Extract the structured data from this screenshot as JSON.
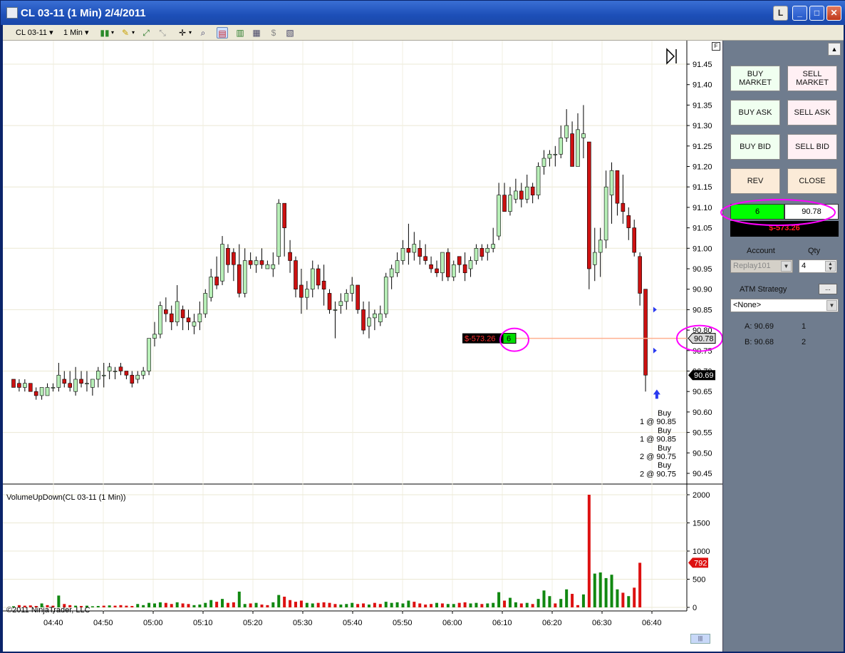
{
  "window": {
    "title": "CL 03-11 (1 Min)  2/4/2011",
    "layout_btn": "L",
    "min_btn": "_",
    "max_btn": "□",
    "close_btn": "✕"
  },
  "toolbar": {
    "instrument": "CL 03-11",
    "interval": "1 Min"
  },
  "chart": {
    "f_label": "F",
    "indicator_label": "VolumeUpDown(CL 03-11 (1 Min))",
    "copyright": "©2011 NinjaTrader, LLC",
    "last_price_label": "90.69",
    "pos_price_label": "90.78",
    "volume_last_label": "792",
    "pos_pnl_label": "$-573.26",
    "pos_qty_label": "6",
    "executions": [
      "Buy",
      "1 @ 90.85",
      "Buy",
      "1 @ 90.85",
      "Buy",
      "2 @ 90.75",
      "Buy",
      "2 @ 90.75"
    ]
  },
  "chart_data": {
    "type": "candlestick",
    "price_axis": {
      "min": 90.45,
      "max": 91.45,
      "ticks": [
        "91.45",
        "91.40",
        "91.35",
        "91.30",
        "91.25",
        "91.20",
        "91.15",
        "91.10",
        "91.05",
        "91.00",
        "90.95",
        "90.90",
        "90.85",
        "90.80",
        "90.75",
        "90.70",
        "90.65",
        "90.60",
        "90.55",
        "90.50",
        "90.45"
      ]
    },
    "volume_axis": {
      "min": 0,
      "max": 2000,
      "ticks": [
        "2000",
        "1500",
        "1000",
        "500",
        "0"
      ]
    },
    "time_ticks": [
      "04:40",
      "04:50",
      "05:00",
      "05:10",
      "05:20",
      "05:30",
      "05:40",
      "05:50",
      "06:00",
      "06:10",
      "06:20",
      "06:30",
      "06:40"
    ],
    "candles": [
      [
        90.68,
        90.68,
        90.66,
        90.66
      ],
      [
        90.67,
        90.68,
        90.65,
        90.66
      ],
      [
        90.66,
        90.68,
        90.65,
        90.67
      ],
      [
        90.67,
        90.67,
        90.65,
        90.65
      ],
      [
        90.65,
        90.66,
        90.63,
        90.64
      ],
      [
        90.64,
        90.66,
        90.63,
        90.66
      ],
      [
        90.64,
        90.67,
        90.64,
        90.66
      ],
      [
        90.66,
        90.67,
        90.65,
        90.66
      ],
      [
        90.66,
        90.72,
        90.65,
        90.69
      ],
      [
        90.68,
        90.7,
        90.66,
        90.67
      ],
      [
        90.67,
        90.7,
        90.65,
        90.66
      ],
      [
        90.65,
        90.71,
        90.64,
        90.68
      ],
      [
        90.68,
        90.7,
        90.66,
        90.67
      ],
      [
        90.67,
        90.7,
        90.65,
        90.67
      ],
      [
        90.66,
        90.68,
        90.64,
        90.68
      ],
      [
        90.68,
        90.71,
        90.66,
        90.7
      ],
      [
        90.69,
        90.72,
        90.66,
        90.69
      ],
      [
        90.7,
        90.72,
        90.68,
        90.71
      ],
      [
        90.7,
        90.71,
        90.68,
        90.7
      ],
      [
        90.71,
        90.72,
        90.69,
        90.7
      ],
      [
        90.7,
        90.7,
        90.68,
        90.69
      ],
      [
        90.69,
        90.7,
        90.66,
        90.67
      ],
      [
        90.68,
        90.7,
        90.67,
        90.69
      ],
      [
        90.69,
        90.71,
        90.68,
        90.7
      ],
      [
        90.7,
        90.76,
        90.69,
        90.78
      ],
      [
        90.78,
        90.82,
        90.76,
        90.79
      ],
      [
        90.79,
        90.87,
        90.78,
        90.86
      ],
      [
        90.85,
        90.88,
        90.82,
        90.84
      ],
      [
        90.84,
        90.86,
        90.8,
        90.82
      ],
      [
        90.82,
        90.91,
        90.81,
        90.87
      ],
      [
        90.85,
        90.86,
        90.8,
        90.83
      ],
      [
        90.83,
        90.85,
        90.8,
        90.82
      ],
      [
        90.81,
        90.84,
        90.79,
        90.82
      ],
      [
        90.82,
        90.87,
        90.8,
        90.84
      ],
      [
        90.84,
        90.9,
        90.83,
        90.89
      ],
      [
        90.88,
        90.95,
        90.87,
        90.93
      ],
      [
        90.93,
        90.98,
        90.9,
        90.91
      ],
      [
        90.92,
        91.03,
        90.91,
        91.01
      ],
      [
        91.0,
        91.01,
        90.94,
        90.96
      ],
      [
        90.99,
        91.0,
        90.92,
        90.96
      ],
      [
        90.96,
        91.01,
        90.88,
        90.89
      ],
      [
        90.89,
        91.0,
        90.88,
        90.97
      ],
      [
        90.97,
        90.99,
        90.95,
        90.96
      ],
      [
        90.96,
        90.98,
        90.94,
        90.97
      ],
      [
        90.97,
        91.0,
        90.95,
        90.96
      ],
      [
        90.95,
        90.97,
        90.95,
        90.96
      ],
      [
        90.95,
        90.99,
        90.93,
        90.96
      ],
      [
        90.98,
        91.12,
        90.96,
        91.11
      ],
      [
        91.11,
        91.1,
        90.98,
        91.05
      ],
      [
        90.99,
        91.02,
        90.94,
        90.97
      ],
      [
        90.97,
        90.98,
        90.88,
        90.9
      ],
      [
        90.91,
        90.95,
        90.84,
        90.88
      ],
      [
        90.88,
        90.92,
        90.85,
        90.9
      ],
      [
        90.9,
        90.97,
        90.88,
        90.95
      ],
      [
        90.95,
        90.96,
        90.9,
        90.91
      ],
      [
        90.92,
        90.96,
        90.86,
        90.9
      ],
      [
        90.89,
        90.9,
        90.84,
        90.85
      ],
      [
        90.85,
        90.87,
        90.78,
        90.85
      ],
      [
        90.86,
        90.89,
        90.84,
        90.87
      ],
      [
        90.87,
        90.9,
        90.85,
        90.89
      ],
      [
        90.89,
        90.93,
        90.87,
        90.91
      ],
      [
        90.91,
        90.91,
        90.84,
        90.85
      ],
      [
        90.85,
        90.87,
        90.79,
        90.8
      ],
      [
        90.81,
        90.87,
        90.78,
        90.83
      ],
      [
        90.83,
        90.85,
        90.8,
        90.84
      ],
      [
        90.82,
        90.86,
        90.81,
        90.84
      ],
      [
        90.84,
        90.94,
        90.83,
        90.93
      ],
      [
        90.93,
        90.96,
        90.9,
        90.95
      ],
      [
        90.94,
        90.99,
        90.93,
        90.97
      ],
      [
        90.97,
        91.02,
        90.96,
        91.0
      ],
      [
        91.0,
        91.06,
        90.96,
        90.99
      ],
      [
        90.99,
        91.04,
        90.97,
        91.01
      ],
      [
        91.0,
        91.02,
        90.96,
        90.98
      ],
      [
        90.98,
        91.01,
        90.96,
        90.97
      ],
      [
        90.96,
        90.98,
        90.94,
        90.95
      ],
      [
        90.95,
        90.97,
        90.93,
        90.94
      ],
      [
        90.94,
        90.98,
        90.92,
        90.99
      ],
      [
        90.99,
        91.0,
        90.92,
        90.93
      ],
      [
        90.93,
        90.97,
        90.92,
        90.96
      ],
      [
        90.98,
        90.98,
        90.94,
        90.96
      ],
      [
        90.96,
        90.99,
        90.92,
        90.94
      ],
      [
        90.95,
        90.98,
        90.93,
        90.97
      ],
      [
        90.97,
        91.01,
        90.96,
        91.0
      ],
      [
        91.0,
        91.01,
        90.97,
        90.98
      ],
      [
        90.99,
        91.01,
        90.97,
        91.0
      ],
      [
        91.0,
        91.05,
        90.99,
        91.01
      ],
      [
        91.03,
        91.16,
        91.02,
        91.13
      ],
      [
        91.13,
        91.16,
        91.09,
        91.09
      ],
      [
        91.09,
        91.15,
        91.08,
        91.13
      ],
      [
        91.12,
        91.17,
        91.11,
        91.14
      ],
      [
        91.14,
        91.16,
        91.1,
        91.12
      ],
      [
        91.12,
        91.18,
        91.11,
        91.15
      ],
      [
        91.15,
        91.16,
        91.11,
        91.13
      ],
      [
        91.13,
        91.21,
        91.12,
        91.2
      ],
      [
        91.2,
        91.24,
        91.18,
        91.22
      ],
      [
        91.22,
        91.24,
        91.2,
        91.23
      ],
      [
        91.23,
        91.25,
        91.2,
        91.23
      ],
      [
        91.23,
        91.3,
        91.22,
        91.27
      ],
      [
        91.27,
        91.34,
        91.26,
        91.3
      ],
      [
        91.28,
        91.31,
        91.2,
        91.2
      ],
      [
        91.2,
        91.33,
        91.2,
        91.29
      ],
      [
        91.27,
        91.35,
        91.22,
        91.28
      ],
      [
        91.26,
        91.26,
        90.9,
        90.95
      ],
      [
        90.96,
        91.05,
        90.92,
        90.99
      ],
      [
        90.99,
        91.05,
        90.93,
        91.02
      ],
      [
        91.02,
        91.19,
        91.0,
        91.15
      ],
      [
        91.13,
        91.21,
        91.06,
        91.19
      ],
      [
        91.19,
        91.19,
        91.08,
        91.11
      ],
      [
        91.11,
        91.18,
        91.06,
        91.09
      ],
      [
        91.08,
        91.1,
        91.02,
        91.05
      ],
      [
        91.05,
        91.07,
        90.98,
        90.99
      ],
      [
        90.98,
        90.99,
        90.86,
        90.89
      ],
      [
        90.9,
        90.9,
        90.65,
        90.69
      ]
    ],
    "volume": [
      [
        20,
        "up"
      ],
      [
        40,
        "dn"
      ],
      [
        30,
        "dn"
      ],
      [
        35,
        "dn"
      ],
      [
        25,
        "dn"
      ],
      [
        70,
        "up"
      ],
      [
        40,
        "dn"
      ],
      [
        30,
        "dn"
      ],
      [
        210,
        "up"
      ],
      [
        60,
        "dn"
      ],
      [
        40,
        "dn"
      ],
      [
        30,
        "up"
      ],
      [
        25,
        "dn"
      ],
      [
        30,
        "up"
      ],
      [
        20,
        "up"
      ],
      [
        25,
        "up"
      ],
      [
        30,
        "dn"
      ],
      [
        35,
        "up"
      ],
      [
        30,
        "dn"
      ],
      [
        40,
        "dn"
      ],
      [
        30,
        "dn"
      ],
      [
        25,
        "dn"
      ],
      [
        60,
        "up"
      ],
      [
        40,
        "up"
      ],
      [
        80,
        "up"
      ],
      [
        70,
        "up"
      ],
      [
        90,
        "up"
      ],
      [
        80,
        "dn"
      ],
      [
        60,
        "dn"
      ],
      [
        90,
        "up"
      ],
      [
        70,
        "dn"
      ],
      [
        60,
        "dn"
      ],
      [
        40,
        "up"
      ],
      [
        50,
        "up"
      ],
      [
        80,
        "up"
      ],
      [
        130,
        "up"
      ],
      [
        100,
        "dn"
      ],
      [
        150,
        "up"
      ],
      [
        80,
        "dn"
      ],
      [
        90,
        "dn"
      ],
      [
        280,
        "up"
      ],
      [
        60,
        "up"
      ],
      [
        70,
        "dn"
      ],
      [
        80,
        "up"
      ],
      [
        50,
        "dn"
      ],
      [
        40,
        "dn"
      ],
      [
        90,
        "up"
      ],
      [
        220,
        "up"
      ],
      [
        190,
        "dn"
      ],
      [
        130,
        "dn"
      ],
      [
        100,
        "dn"
      ],
      [
        120,
        "dn"
      ],
      [
        80,
        "up"
      ],
      [
        70,
        "up"
      ],
      [
        80,
        "dn"
      ],
      [
        90,
        "dn"
      ],
      [
        80,
        "dn"
      ],
      [
        60,
        "dn"
      ],
      [
        50,
        "up"
      ],
      [
        60,
        "up"
      ],
      [
        80,
        "up"
      ],
      [
        60,
        "dn"
      ],
      [
        70,
        "dn"
      ],
      [
        50,
        "up"
      ],
      [
        80,
        "dn"
      ],
      [
        60,
        "dn"
      ],
      [
        100,
        "up"
      ],
      [
        80,
        "up"
      ],
      [
        90,
        "up"
      ],
      [
        70,
        "up"
      ],
      [
        120,
        "up"
      ],
      [
        100,
        "dn"
      ],
      [
        70,
        "dn"
      ],
      [
        50,
        "dn"
      ],
      [
        60,
        "dn"
      ],
      [
        80,
        "up"
      ],
      [
        70,
        "dn"
      ],
      [
        60,
        "up"
      ],
      [
        60,
        "up"
      ],
      [
        80,
        "dn"
      ],
      [
        90,
        "dn"
      ],
      [
        70,
        "up"
      ],
      [
        80,
        "up"
      ],
      [
        60,
        "dn"
      ],
      [
        70,
        "up"
      ],
      [
        80,
        "up"
      ],
      [
        270,
        "up"
      ],
      [
        120,
        "dn"
      ],
      [
        170,
        "up"
      ],
      [
        90,
        "up"
      ],
      [
        70,
        "dn"
      ],
      [
        80,
        "up"
      ],
      [
        60,
        "dn"
      ],
      [
        150,
        "up"
      ],
      [
        300,
        "up"
      ],
      [
        200,
        "up"
      ],
      [
        70,
        "dn"
      ],
      [
        150,
        "up"
      ],
      [
        320,
        "up"
      ],
      [
        240,
        "dn"
      ],
      [
        40,
        "dn"
      ],
      [
        230,
        "up"
      ],
      [
        2000,
        "dn"
      ],
      [
        600,
        "up"
      ],
      [
        620,
        "up"
      ],
      [
        520,
        "up"
      ],
      [
        580,
        "up"
      ],
      [
        320,
        "up"
      ],
      [
        260,
        "dn"
      ],
      [
        200,
        "up"
      ],
      [
        350,
        "dn"
      ],
      [
        792,
        "dn"
      ]
    ]
  },
  "panel": {
    "buy_market": "BUY MARKET",
    "sell_market": "SELL MARKET",
    "buy_ask": "BUY ASK",
    "sell_ask": "SELL ASK",
    "buy_bid": "BUY BID",
    "sell_bid": "SELL BID",
    "rev": "REV",
    "close": "CLOSE",
    "position_qty": "6",
    "position_price": "90.78",
    "pnl": "$-573.26",
    "account_label": "Account",
    "qty_label": "Qty",
    "account_value": "Replay101",
    "qty_value": "4",
    "atm_label": "ATM Strategy",
    "atm_btn": "...",
    "atm_value": "<None>",
    "ask_label": "A: 90.69",
    "ask_qty": "1",
    "bid_label": "B: 90.68",
    "bid_qty": "2"
  },
  "colors": {
    "up_candle": "#b8f0b8",
    "down_candle": "#cc1111",
    "up_volume": "#118811",
    "down_volume": "#dd1111",
    "annotation": "#ff00ff"
  }
}
